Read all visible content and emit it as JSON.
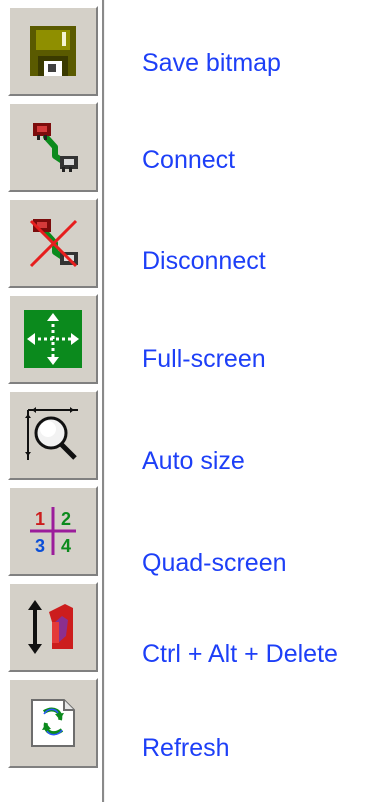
{
  "toolbar": {
    "items": [
      {
        "label": "Save bitmap",
        "icon": "floppy-disk-icon"
      },
      {
        "label": "Connect",
        "icon": "connect-icon"
      },
      {
        "label": "Disconnect",
        "icon": "disconnect-icon"
      },
      {
        "label": "Full-screen",
        "icon": "full-screen-icon"
      },
      {
        "label": "Auto size",
        "icon": "auto-size-icon"
      },
      {
        "label": "Quad-screen",
        "icon": "quad-screen-icon"
      },
      {
        "label": "Ctrl + Alt + Delete",
        "icon": "ctrl-alt-delete-icon"
      },
      {
        "label": "Refresh",
        "icon": "refresh-icon"
      }
    ]
  },
  "colors": {
    "label_text": "#1d3ff7",
    "button_face": "#d4d0c8",
    "icon_dark_olive": "#4c4c00",
    "icon_yellow_olive": "#8f8f00",
    "icon_green": "#0b8a1d",
    "icon_red": "#cc1d1d",
    "icon_purple": "#8b2f8f"
  },
  "quad_numbers": [
    "1",
    "2",
    "3",
    "4"
  ]
}
